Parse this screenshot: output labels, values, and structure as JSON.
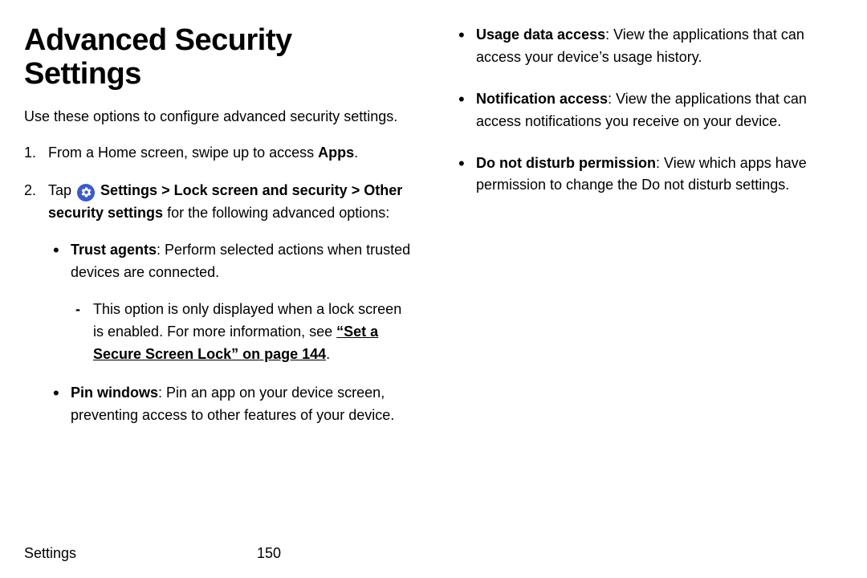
{
  "title": "Advanced Security Settings",
  "intro": "Use these options to configure advanced security settings.",
  "steps": {
    "s1_a": "From a Home screen, swipe up to access ",
    "s1_b": "Apps",
    "s1_c": ".",
    "s2_a": "Tap ",
    "s2_b": "Settings",
    "s2_c": " > ",
    "s2_d": "Lock screen and security",
    "s2_e": " > ",
    "s2_f": "Other security settings",
    "s2_g": " for the following advanced options:"
  },
  "leftBullets": {
    "b1_title": "Trust agents",
    "b1_body": ": Perform selected actions when trusted devices are connected.",
    "b1_dash_a": "This option is only displayed when a lock screen is enabled. For more information, see ",
    "b1_dash_link": "“Set a Secure Screen Lock” on page 144",
    "b1_dash_c": ".",
    "b2_title": "Pin windows",
    "b2_body": ": Pin an app on your device screen, preventing access to other features of your device."
  },
  "rightBullets": {
    "r1_title": "Usage data access",
    "r1_body": ": View the applications that can access your device’s usage history.",
    "r2_title": "Notification access",
    "r2_body": ": View the applications that can access notifications you receive on your device.",
    "r3_title": "Do not disturb permission",
    "r3_body": ": View which apps have permission to change the Do not disturb settings."
  },
  "footer": {
    "section": "Settings",
    "page": "150"
  }
}
